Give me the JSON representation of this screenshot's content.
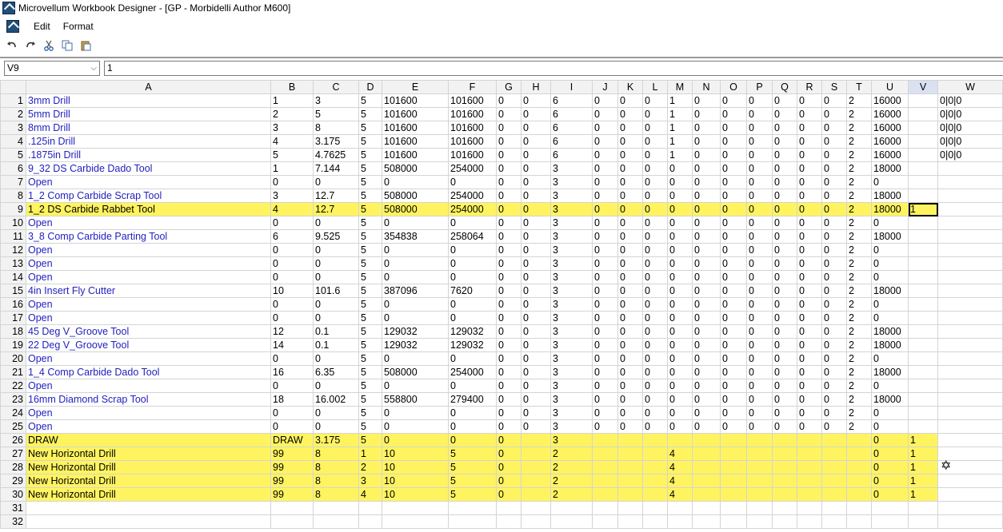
{
  "window": {
    "title": "Microvellum Workbook Designer - [GP - Morbidelli Author M600]"
  },
  "menu": {
    "items": [
      "Edit",
      "Format"
    ]
  },
  "toolbar": {
    "icons": [
      "undo-icon",
      "redo-icon",
      "cut-icon",
      "copy-icon",
      "paste-icon"
    ]
  },
  "formula": {
    "cell_ref": "V9",
    "value": "1"
  },
  "highlight_color": "#fff460",
  "grid": {
    "columns": [
      "A",
      "B",
      "C",
      "D",
      "E",
      "F",
      "G",
      "H",
      "I",
      "J",
      "K",
      "L",
      "M",
      "N",
      "O",
      "P",
      "Q",
      "R",
      "S",
      "T",
      "U",
      "V",
      "W"
    ],
    "active_cell": {
      "row": 9,
      "col": "V"
    },
    "highlight_rows": [
      9,
      26,
      27,
      28,
      29,
      30
    ],
    "rows": [
      [
        "3mm Drill",
        "1",
        "3",
        "5",
        "101600",
        "101600",
        "0",
        "0",
        "6",
        "0",
        "0",
        "0",
        "1",
        "0",
        "0",
        "0",
        "0",
        "0",
        "0",
        "2",
        "16000",
        "",
        "0|0|0"
      ],
      [
        "5mm Drill",
        "2",
        "5",
        "5",
        "101600",
        "101600",
        "0",
        "0",
        "6",
        "0",
        "0",
        "0",
        "1",
        "0",
        "0",
        "0",
        "0",
        "0",
        "0",
        "2",
        "16000",
        "",
        "0|0|0"
      ],
      [
        "8mm Drill",
        "3",
        "8",
        "5",
        "101600",
        "101600",
        "0",
        "0",
        "6",
        "0",
        "0",
        "0",
        "1",
        "0",
        "0",
        "0",
        "0",
        "0",
        "0",
        "2",
        "16000",
        "",
        "0|0|0"
      ],
      [
        ".125in Drill",
        "4",
        "3.175",
        "5",
        "101600",
        "101600",
        "0",
        "0",
        "6",
        "0",
        "0",
        "0",
        "1",
        "0",
        "0",
        "0",
        "0",
        "0",
        "0",
        "2",
        "16000",
        "",
        "0|0|0"
      ],
      [
        ".1875in Drill",
        "5",
        "4.7625",
        "5",
        "101600",
        "101600",
        "0",
        "0",
        "6",
        "0",
        "0",
        "0",
        "1",
        "0",
        "0",
        "0",
        "0",
        "0",
        "0",
        "2",
        "16000",
        "",
        "0|0|0"
      ],
      [
        "9_32 DS Carbide Dado Tool",
        "1",
        "7.144",
        "5",
        "508000",
        "254000",
        "0",
        "0",
        "3",
        "0",
        "0",
        "0",
        "0",
        "0",
        "0",
        "0",
        "0",
        "0",
        "0",
        "2",
        "18000",
        "",
        ""
      ],
      [
        "Open",
        "0",
        "0",
        "5",
        "0",
        "0",
        "0",
        "0",
        "3",
        "0",
        "0",
        "0",
        "0",
        "0",
        "0",
        "0",
        "0",
        "0",
        "0",
        "2",
        "0",
        "",
        ""
      ],
      [
        "1_2 Comp Carbide Scrap Tool",
        "3",
        "12.7",
        "5",
        "508000",
        "254000",
        "0",
        "0",
        "3",
        "0",
        "0",
        "0",
        "0",
        "0",
        "0",
        "0",
        "0",
        "0",
        "0",
        "2",
        "18000",
        "",
        ""
      ],
      [
        "1_2 DS Carbide Rabbet Tool",
        "4",
        "12.7",
        "5",
        "508000",
        "254000",
        "0",
        "0",
        "3",
        "0",
        "0",
        "0",
        "0",
        "0",
        "0",
        "0",
        "0",
        "0",
        "0",
        "2",
        "18000",
        "1",
        ""
      ],
      [
        "Open",
        "0",
        "0",
        "5",
        "0",
        "0",
        "0",
        "0",
        "3",
        "0",
        "0",
        "0",
        "0",
        "0",
        "0",
        "0",
        "0",
        "0",
        "0",
        "2",
        "0",
        "",
        ""
      ],
      [
        "3_8 Comp Carbide Parting Tool",
        "6",
        "9.525",
        "5",
        "354838",
        "258064",
        "0",
        "0",
        "3",
        "0",
        "0",
        "0",
        "0",
        "0",
        "0",
        "0",
        "0",
        "0",
        "0",
        "2",
        "18000",
        "",
        ""
      ],
      [
        "Open",
        "0",
        "0",
        "5",
        "0",
        "0",
        "0",
        "0",
        "3",
        "0",
        "0",
        "0",
        "0",
        "0",
        "0",
        "0",
        "0",
        "0",
        "0",
        "2",
        "0",
        "",
        ""
      ],
      [
        "Open",
        "0",
        "0",
        "5",
        "0",
        "0",
        "0",
        "0",
        "3",
        "0",
        "0",
        "0",
        "0",
        "0",
        "0",
        "0",
        "0",
        "0",
        "0",
        "2",
        "0",
        "",
        ""
      ],
      [
        "Open",
        "0",
        "0",
        "5",
        "0",
        "0",
        "0",
        "0",
        "3",
        "0",
        "0",
        "0",
        "0",
        "0",
        "0",
        "0",
        "0",
        "0",
        "0",
        "2",
        "0",
        "",
        ""
      ],
      [
        "4in Insert Fly Cutter",
        "10",
        "101.6",
        "5",
        "387096",
        "7620",
        "0",
        "0",
        "3",
        "0",
        "0",
        "0",
        "0",
        "0",
        "0",
        "0",
        "0",
        "0",
        "0",
        "2",
        "18000",
        "",
        ""
      ],
      [
        "Open",
        "0",
        "0",
        "5",
        "0",
        "0",
        "0",
        "0",
        "3",
        "0",
        "0",
        "0",
        "0",
        "0",
        "0",
        "0",
        "0",
        "0",
        "0",
        "2",
        "0",
        "",
        ""
      ],
      [
        "Open",
        "0",
        "0",
        "5",
        "0",
        "0",
        "0",
        "0",
        "3",
        "0",
        "0",
        "0",
        "0",
        "0",
        "0",
        "0",
        "0",
        "0",
        "0",
        "2",
        "0",
        "",
        ""
      ],
      [
        "45 Deg V_Groove Tool",
        "12",
        "0.1",
        "5",
        "129032",
        "129032",
        "0",
        "0",
        "3",
        "0",
        "0",
        "0",
        "0",
        "0",
        "0",
        "0",
        "0",
        "0",
        "0",
        "2",
        "18000",
        "",
        ""
      ],
      [
        "22 Deg V_Groove Tool",
        "14",
        "0.1",
        "5",
        "129032",
        "129032",
        "0",
        "0",
        "3",
        "0",
        "0",
        "0",
        "0",
        "0",
        "0",
        "0",
        "0",
        "0",
        "0",
        "2",
        "18000",
        "",
        ""
      ],
      [
        "Open",
        "0",
        "0",
        "5",
        "0",
        "0",
        "0",
        "0",
        "3",
        "0",
        "0",
        "0",
        "0",
        "0",
        "0",
        "0",
        "0",
        "0",
        "0",
        "2",
        "0",
        "",
        ""
      ],
      [
        "1_4 Comp Carbide Dado Tool",
        "16",
        "6.35",
        "5",
        "508000",
        "254000",
        "0",
        "0",
        "3",
        "0",
        "0",
        "0",
        "0",
        "0",
        "0",
        "0",
        "0",
        "0",
        "0",
        "2",
        "18000",
        "",
        ""
      ],
      [
        "Open",
        "0",
        "0",
        "5",
        "0",
        "0",
        "0",
        "0",
        "3",
        "0",
        "0",
        "0",
        "0",
        "0",
        "0",
        "0",
        "0",
        "0",
        "0",
        "2",
        "0",
        "",
        ""
      ],
      [
        "16mm Diamond Scrap Tool",
        "18",
        "16.002",
        "5",
        "558800",
        "279400",
        "0",
        "0",
        "3",
        "0",
        "0",
        "0",
        "0",
        "0",
        "0",
        "0",
        "0",
        "0",
        "0",
        "2",
        "18000",
        "",
        ""
      ],
      [
        "Open",
        "0",
        "0",
        "5",
        "0",
        "0",
        "0",
        "0",
        "3",
        "0",
        "0",
        "0",
        "0",
        "0",
        "0",
        "0",
        "0",
        "0",
        "0",
        "2",
        "0",
        "",
        ""
      ],
      [
        "Open",
        "0",
        "0",
        "5",
        "0",
        "0",
        "0",
        "0",
        "3",
        "0",
        "0",
        "0",
        "0",
        "0",
        "0",
        "0",
        "0",
        "0",
        "0",
        "2",
        "0",
        "",
        ""
      ],
      [
        "DRAW",
        "DRAW",
        "3.175",
        "5",
        "0",
        "0",
        "0",
        "",
        "3",
        "",
        "",
        "",
        "",
        "",
        "",
        "",
        "",
        "",
        "",
        "",
        "0",
        "1",
        ""
      ],
      [
        "New Horizontal Drill",
        "99",
        "8",
        "1",
        "10",
        "5",
        "0",
        "",
        "2",
        "",
        "",
        "",
        "4",
        "",
        "",
        "",
        "",
        "",
        "",
        "",
        "0",
        "1",
        ""
      ],
      [
        "New Horizontal Drill",
        "99",
        "8",
        "2",
        "10",
        "5",
        "0",
        "",
        "2",
        "",
        "",
        "",
        "4",
        "",
        "",
        "",
        "",
        "",
        "",
        "",
        "0",
        "1",
        ""
      ],
      [
        "New Horizontal Drill",
        "99",
        "8",
        "3",
        "10",
        "5",
        "0",
        "",
        "2",
        "",
        "",
        "",
        "4",
        "",
        "",
        "",
        "",
        "",
        "",
        "",
        "0",
        "1",
        ""
      ],
      [
        "New Horizontal Drill",
        "99",
        "8",
        "4",
        "10",
        "5",
        "0",
        "",
        "2",
        "",
        "",
        "",
        "4",
        "",
        "",
        "",
        "",
        "",
        "",
        "",
        "0",
        "1",
        ""
      ],
      [
        "",
        "",
        "",
        "",
        "",
        "",
        "",
        "",
        "",
        "",
        "",
        "",
        "",
        "",
        "",
        "",
        "",
        "",
        "",
        "",
        "",
        "",
        ""
      ],
      [
        "",
        "",
        "",
        "",
        "",
        "",
        "",
        "",
        "",
        "",
        "",
        "",
        "",
        "",
        "",
        "",
        "",
        "",
        "",
        "",
        "",
        "",
        ""
      ]
    ]
  }
}
